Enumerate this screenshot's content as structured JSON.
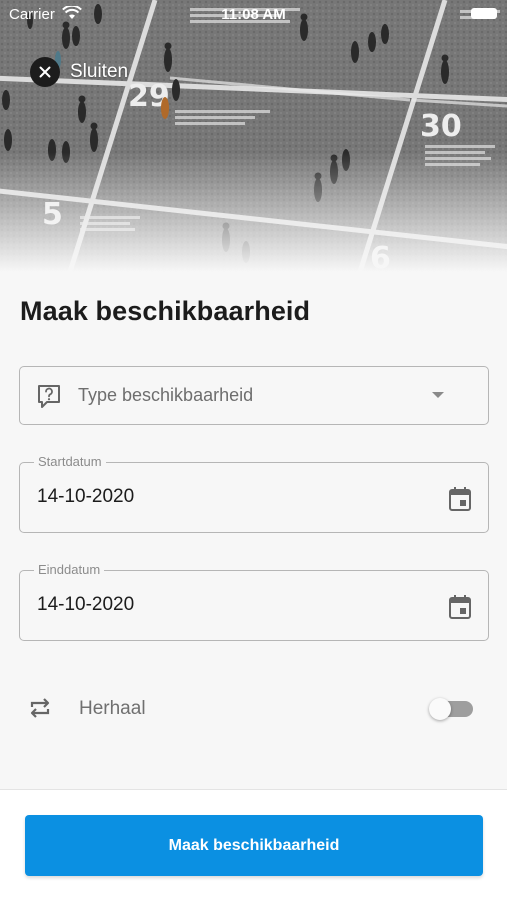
{
  "status_bar": {
    "carrier": "Carrier",
    "time": "11:08 AM"
  },
  "header": {
    "close_label": "Sluiten",
    "close_icon": "close-icon"
  },
  "page": {
    "title": "Maak beschikbaarheid"
  },
  "form": {
    "type_field": {
      "placeholder": "Type beschikbaarheid",
      "icon": "question-bubble-icon"
    },
    "start_date": {
      "label": "Startdatum",
      "value": "14-10-2020",
      "icon": "calendar-icon"
    },
    "end_date": {
      "label": "Einddatum",
      "value": "14-10-2020",
      "icon": "calendar-icon"
    },
    "repeat": {
      "label": "Herhaal",
      "icon": "repeat-icon",
      "enabled": false
    }
  },
  "footer": {
    "submit_label": "Maak beschikbaarheid"
  },
  "photo_text": {
    "n5": "5",
    "n29": "29",
    "n30": "30",
    "n6": "6"
  },
  "colors": {
    "primary": "#0b90e2",
    "background": "#f7f7f7",
    "text": "#1c1c1c"
  }
}
